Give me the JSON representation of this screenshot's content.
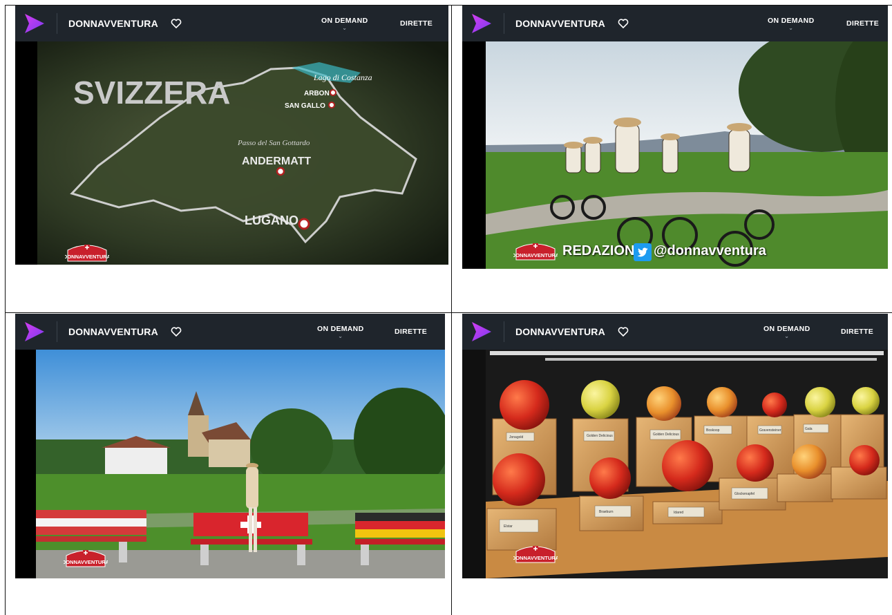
{
  "panels": [
    {
      "show_title": "DONNAVVENTURA",
      "nav": [
        "ON DEMAND",
        "DIRETTE"
      ],
      "map": {
        "country": "SVIZZERA",
        "labels": [
          "Lago di Costanza",
          "ARBON",
          "SAN GALLO",
          "Passo del San Gottardo",
          "ANDERMATT",
          "LUGANO"
        ]
      },
      "bug_text": "DONNAVVENTURA"
    },
    {
      "show_title": "DONNAVVENTURA",
      "nav": [
        "ON DEMAND",
        "DIRETTE"
      ],
      "caption_left": "REDAZIONE",
      "caption_handle": "@donnavventura",
      "bug_text": "DONNAVVENTURA"
    },
    {
      "show_title": "DONNAVVENTURA",
      "nav": [
        "ON DEMAND",
        "DIRETTE"
      ],
      "bug_text": "DONNAVVENTURA"
    },
    {
      "show_title": "DONNAVVENTURA",
      "nav": [
        "ON DEMAND",
        "DIRETTE"
      ],
      "apple_labels": [
        "Jonagold",
        "Golden Delicious",
        "Golden Delicious",
        "Boskoop",
        "Gravensteiner",
        "Elstar",
        "Braeburn",
        "Idared",
        "Glockenapfel",
        "Gala"
      ],
      "bug_text": "DONNAVVENTURA"
    }
  ],
  "colors": {
    "topbar": "#1f252c",
    "logo_purple": "#8b3df0",
    "logo_pink": "#d43df0",
    "bug_red": "#c8202b"
  }
}
